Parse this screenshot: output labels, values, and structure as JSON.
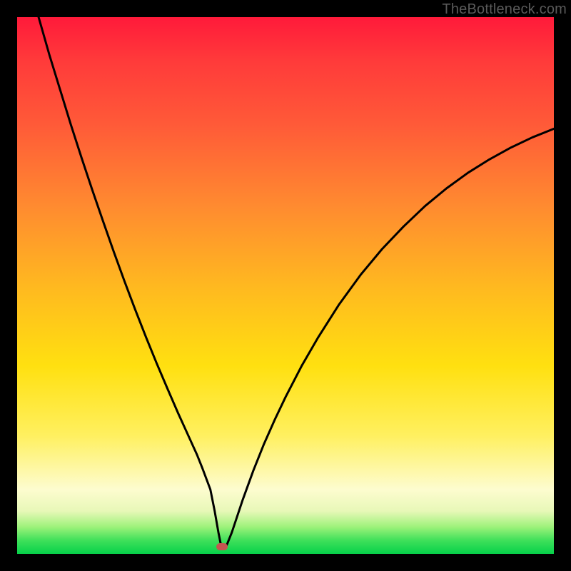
{
  "watermark": "TheBottleneck.com",
  "chart_data": {
    "type": "line",
    "title": "",
    "xlabel": "",
    "ylabel": "",
    "xlim": [
      0,
      100
    ],
    "ylim": [
      0,
      100
    ],
    "grid": false,
    "series": [
      {
        "name": "bottleneck-curve",
        "x": [
          4,
          6,
          8,
          10,
          12,
          14,
          16,
          18,
          20,
          22,
          24,
          26,
          28,
          30,
          32,
          33.5,
          34.5,
          36,
          36.8,
          37.5,
          38,
          39,
          40,
          42,
          44,
          46,
          48,
          50,
          53,
          56,
          60,
          64,
          68,
          72,
          76,
          80,
          84,
          88,
          92,
          96,
          100
        ],
        "values": [
          100,
          93,
          86.5,
          80,
          73.8,
          67.8,
          62,
          56.3,
          50.8,
          45.5,
          40.4,
          35.5,
          30.8,
          26.2,
          21.8,
          18.5,
          16,
          12,
          8,
          4,
          1.5,
          1.5,
          4,
          10,
          15.5,
          20.5,
          25,
          29.2,
          35,
          40.2,
          46.5,
          52,
          56.8,
          61,
          64.8,
          68.1,
          71,
          73.5,
          75.7,
          77.6,
          79.2
        ]
      }
    ],
    "marker": {
      "name": "optimal-point",
      "x": 38.2,
      "y": 1.3,
      "color": "#c55550"
    },
    "gradient_stops": [
      {
        "pos": 0,
        "color": "#ff1a3a"
      },
      {
        "pos": 50,
        "color": "#ffe010"
      },
      {
        "pos": 100,
        "color": "#06d14a"
      }
    ]
  }
}
